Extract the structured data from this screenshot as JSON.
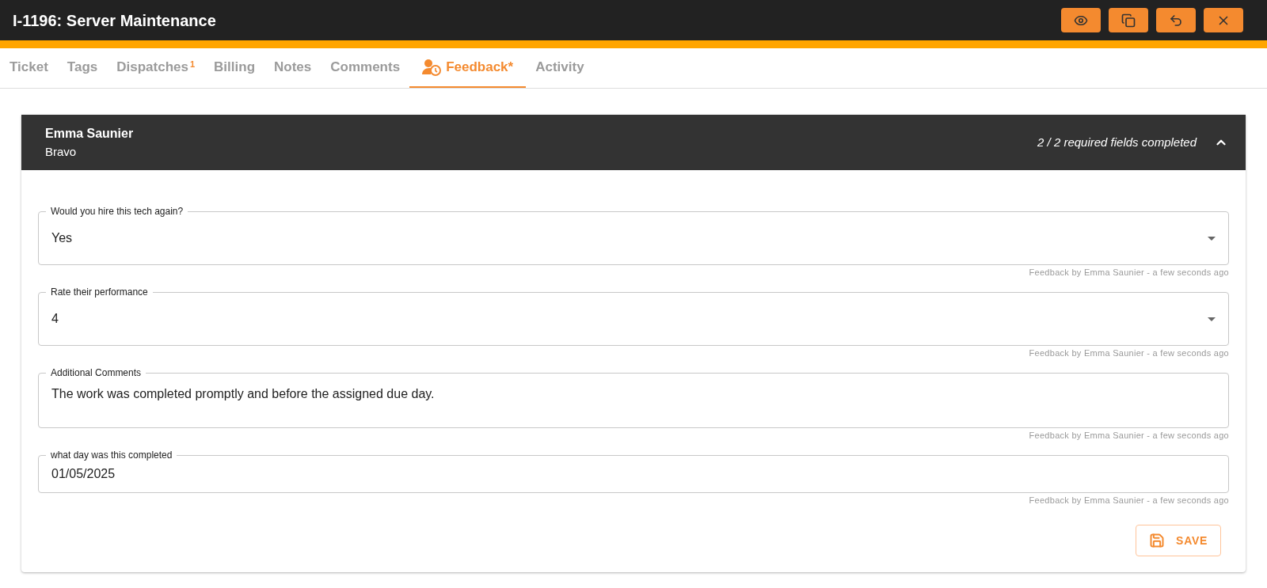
{
  "window": {
    "title": "I-1196: Server Maintenance"
  },
  "toolbar": [
    {
      "kind": "view"
    },
    {
      "kind": "copy"
    },
    {
      "kind": "undo"
    },
    {
      "kind": "close"
    }
  ],
  "tabs": [
    {
      "label": "Ticket",
      "selected": false
    },
    {
      "label": "Tags",
      "selected": false
    },
    {
      "label": "Dispatches",
      "badge": "1",
      "selected": false
    },
    {
      "label": "Billing",
      "selected": false
    },
    {
      "label": "Notes",
      "selected": false
    },
    {
      "label": "Comments",
      "selected": false
    },
    {
      "label": "Feedback*",
      "selected": true,
      "kind": "icon"
    },
    {
      "label": "Activity",
      "selected": false
    }
  ],
  "panel": {
    "name": "Emma Saunier",
    "subtitle": "Bravo",
    "progress": "2 / 2 required fields completed",
    "expanded": true,
    "fields": [
      {
        "kind": "select",
        "label": "Would you hire this tech again?",
        "value": "Yes",
        "note": "Feedback by Emma Saunier - a few seconds ago"
      },
      {
        "kind": "select",
        "label": "Rate their performance",
        "value": "4",
        "note": "Feedback by Emma Saunier - a few seconds ago"
      },
      {
        "kind": "textarea",
        "label": "Additional Comments",
        "value": "The work was completed promptly and before the assigned due day.",
        "note": "Feedback by Emma Saunier - a few seconds ago"
      },
      {
        "kind": "date",
        "label": "what day was this completed",
        "value": "01/05/2025",
        "note": "Feedback by Emma Saunier - a few seconds ago"
      }
    ],
    "save": "SAVE"
  }
}
